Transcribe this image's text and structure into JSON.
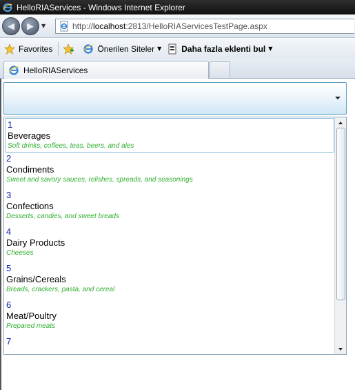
{
  "window": {
    "title": "HelloRIAServices - Windows Internet Explorer"
  },
  "address_bar": {
    "url_prefix": "http://",
    "url_host": "localhost",
    "url_rest": ":2813/HelloRIAServicesTestPage.aspx"
  },
  "favorites_bar": {
    "favorites_label": "Favorites",
    "suggested_sites_label": "Önerilen Siteler",
    "more_addons_label": "Daha fazla eklenti bul"
  },
  "tabs": {
    "active_label": "HelloRIAServices"
  },
  "categories": [
    {
      "id": "1",
      "name": "Beverages",
      "description": "Soft drinks, coffees, teas, beers, and ales"
    },
    {
      "id": "2",
      "name": "Condiments",
      "description": "Sweet and savory sauces, relishes, spreads, and seasonings"
    },
    {
      "id": "3",
      "name": "Confections",
      "description": "Desserts, candies, and sweet breads"
    },
    {
      "id": "4",
      "name": "Dairy Products",
      "description": "Cheeses"
    },
    {
      "id": "5",
      "name": "Grains/Cereals",
      "description": "Breads, crackers, pasta, and cereal"
    },
    {
      "id": "6",
      "name": "Meat/Poultry",
      "description": "Prepared meats"
    },
    {
      "id": "7",
      "name": "",
      "description": ""
    }
  ],
  "selected_index": 0,
  "colors": {
    "id_text": "#0a1ea8",
    "description_text": "#2fae2f",
    "selection_border": "#8cc0dc"
  }
}
